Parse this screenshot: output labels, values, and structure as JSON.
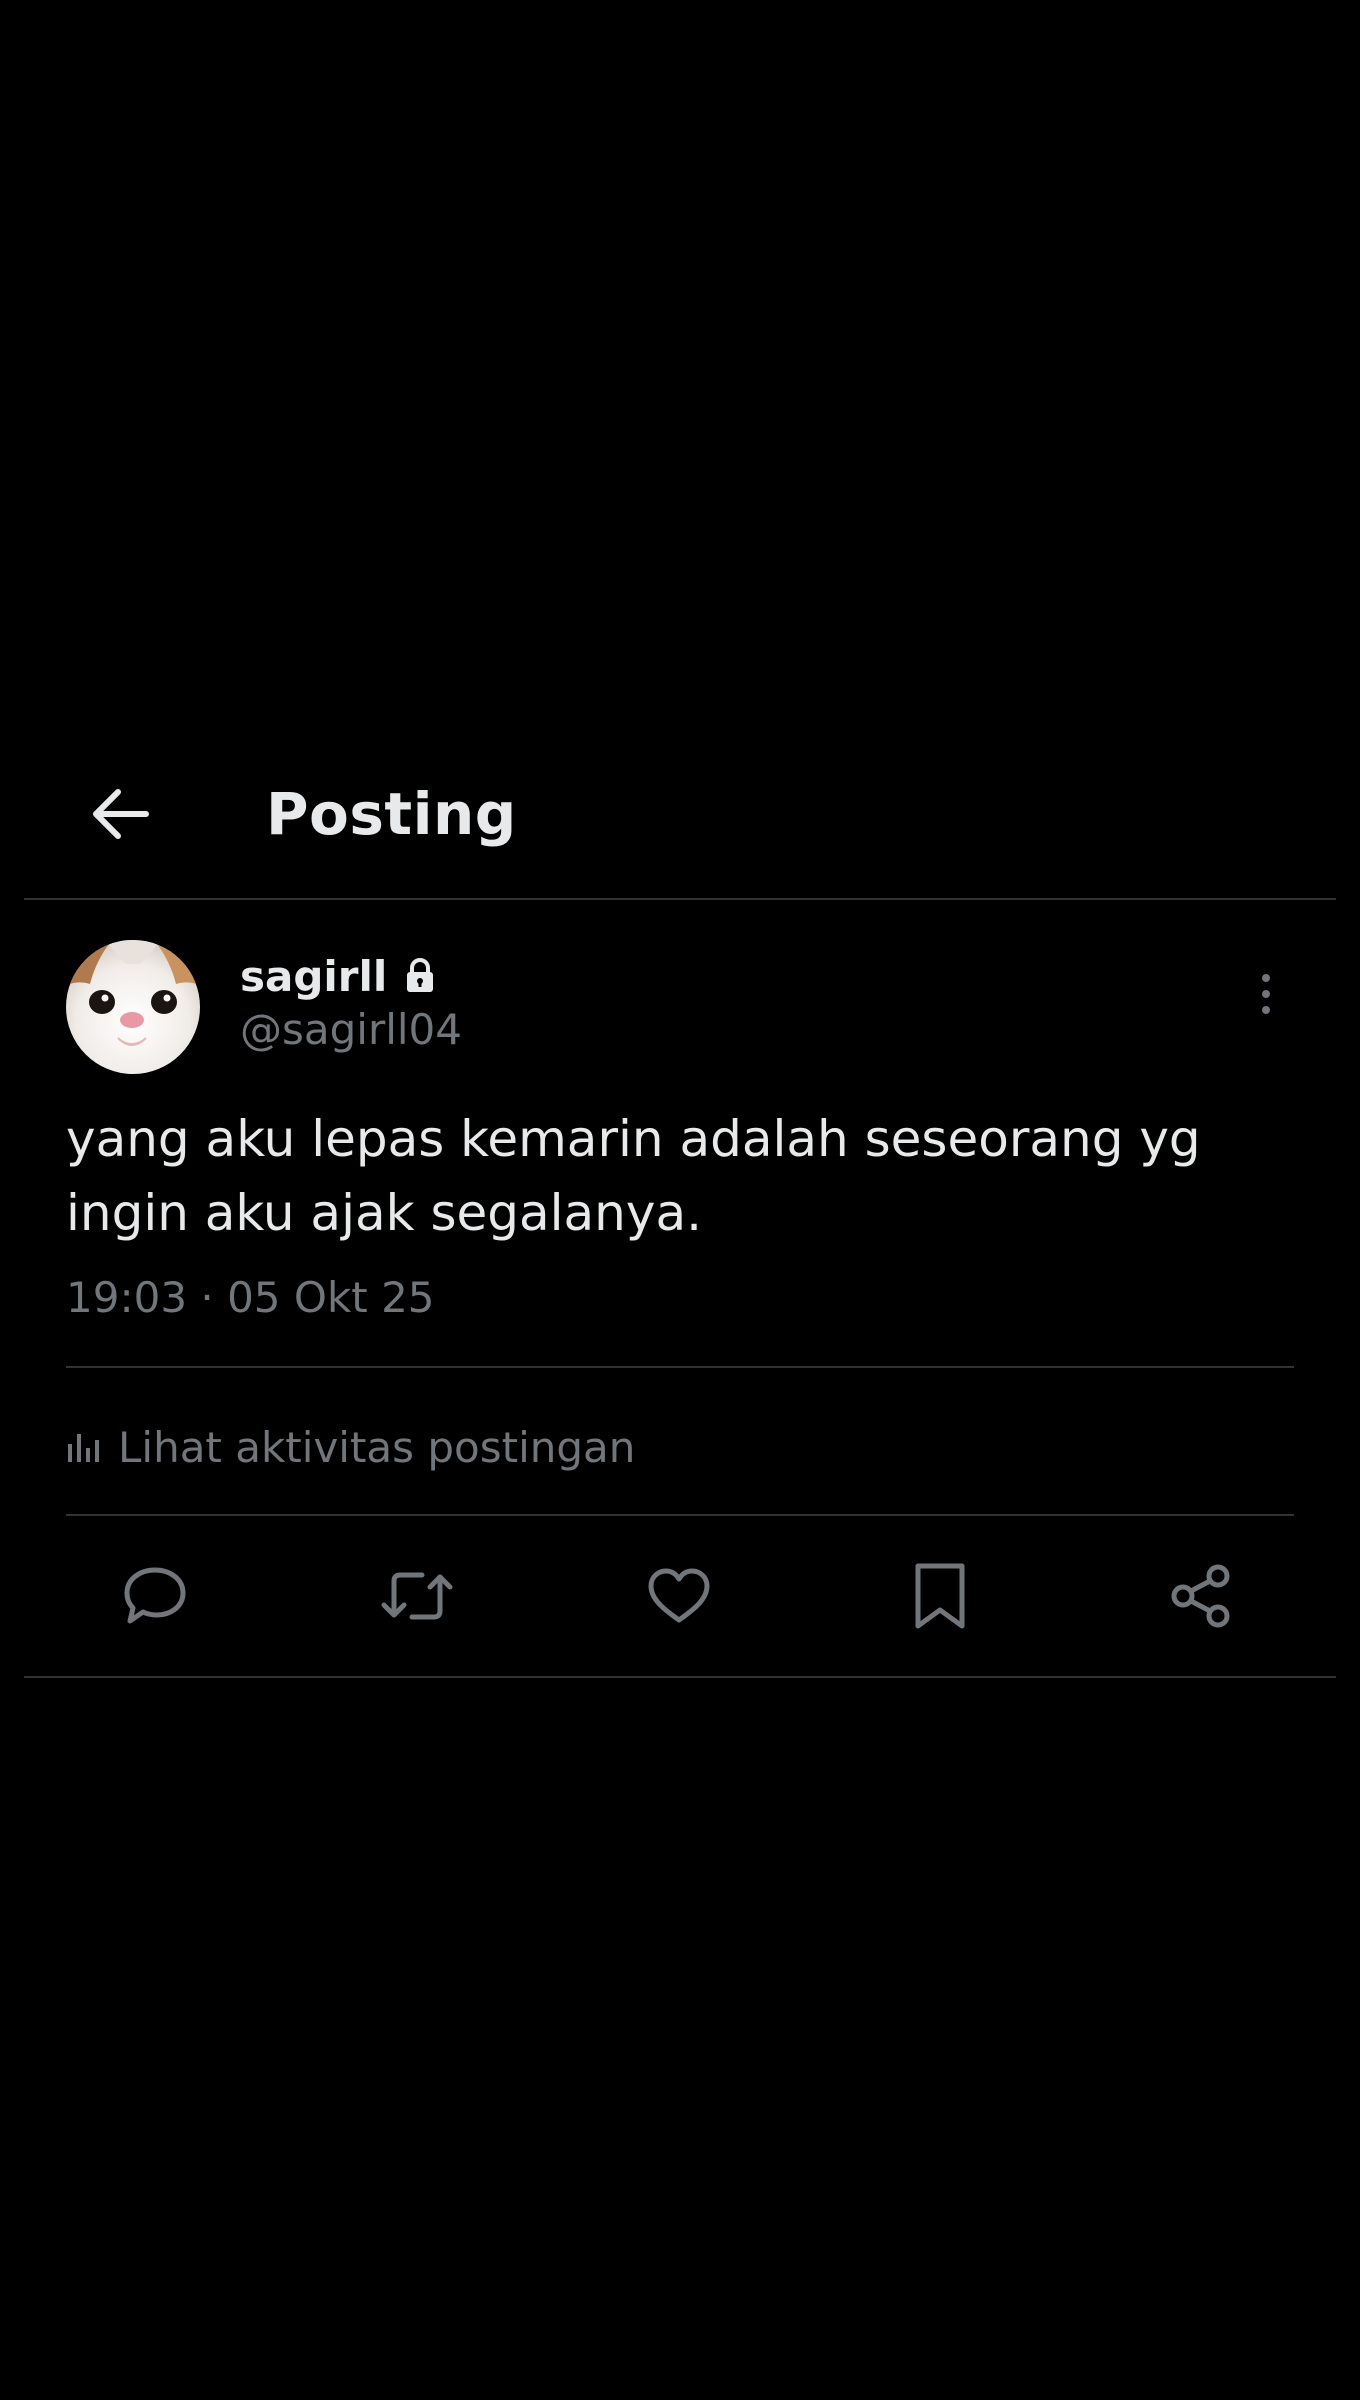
{
  "header": {
    "title": "Posting",
    "back_icon": "arrow-left-icon"
  },
  "post": {
    "author": {
      "display_name": "sagirll",
      "handle": "@sagirll04",
      "protected_icon": "lock-icon",
      "avatar": "cat-face-avatar"
    },
    "text": "yang aku lepas kemarin adalah seseorang yg\ningin aku ajak segalanya.",
    "timestamp": "19:03 · 05 Okt 25",
    "more_icon": "more-vertical-icon",
    "activity": {
      "label": "Lihat aktivitas postingan",
      "icon": "bar-chart-icon"
    },
    "actions": [
      {
        "name": "reply",
        "icon": "reply-icon"
      },
      {
        "name": "repost",
        "icon": "repost-icon"
      },
      {
        "name": "like",
        "icon": "heart-icon"
      },
      {
        "name": "bookmark",
        "icon": "bookmark-icon"
      },
      {
        "name": "share",
        "icon": "share-icon"
      }
    ]
  },
  "colors": {
    "background": "#000000",
    "text_primary": "#e7e9ea",
    "text_secondary": "#71767b",
    "divider": "#2f3336"
  }
}
